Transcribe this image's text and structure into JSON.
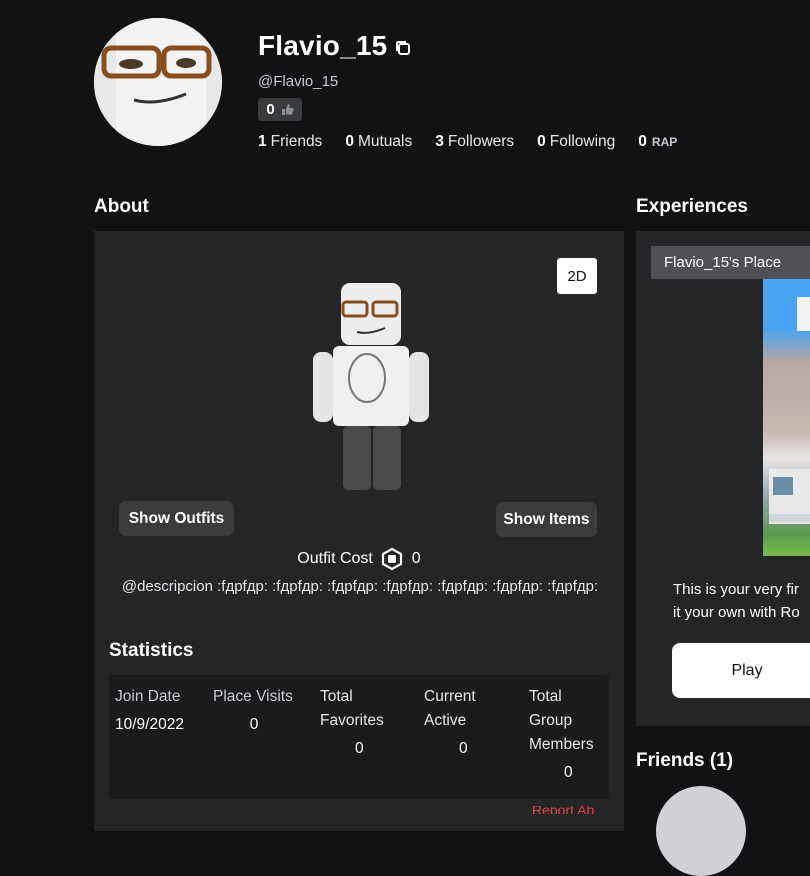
{
  "profile": {
    "display_name": "Flavio_15",
    "handle": "@Flavio_15",
    "likes": "0",
    "stats": [
      {
        "count": "1",
        "label": "Friends"
      },
      {
        "count": "0",
        "label": "Mutuals"
      },
      {
        "count": "3",
        "label": "Followers"
      },
      {
        "count": "0",
        "label": "Following"
      },
      {
        "count": "0",
        "label": "RAP"
      }
    ]
  },
  "about": {
    "title": "About",
    "toggle_label": "2D",
    "show_outfits_label": "Show Outfits",
    "show_items_label": "Show Items",
    "outfit_cost_label": "Outfit Cost",
    "outfit_cost_value": "0",
    "description": "@descripcion :fдpfдp: :fдpfдp: :fдpfдp: :fдpfдp: :fдpfдp: :fдpfдp: :fдpfдp:"
  },
  "statistics": {
    "title": "Statistics",
    "columns": [
      {
        "header_lines": [
          "Join Date"
        ],
        "value": "10/9/2022"
      },
      {
        "header_lines": [
          "Place Visits"
        ],
        "value": "0"
      },
      {
        "header_lines": [
          "Total",
          "Favorites"
        ],
        "value": "0"
      },
      {
        "header_lines": [
          "Current",
          "Active"
        ],
        "value": "0"
      },
      {
        "header_lines": [
          "Total",
          "Group",
          "Members"
        ],
        "value": "0"
      }
    ],
    "bottom_link": "Report Ab"
  },
  "experiences": {
    "title": "Experiences",
    "place_name": "Flavio_15's Place",
    "description_line1": "This is your very fir",
    "description_line2": "it your own with Ro",
    "play_label": "Play"
  },
  "friends": {
    "title": "Friends (1)"
  },
  "colors": {
    "background": "#111214",
    "panel": "#232527",
    "chip": "#393b3d",
    "stat_box": "#191b1d"
  }
}
